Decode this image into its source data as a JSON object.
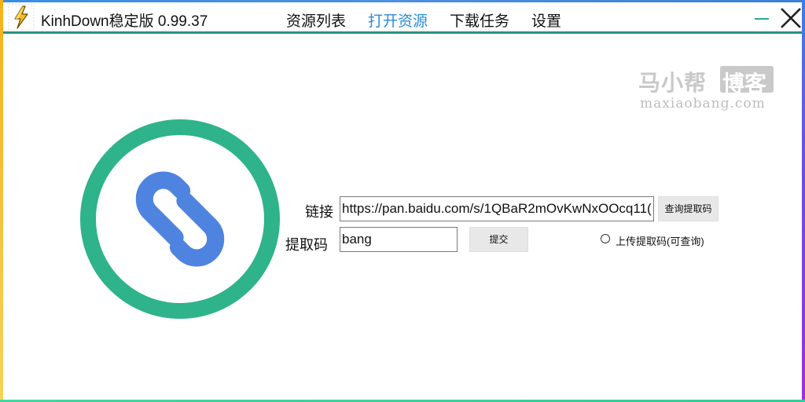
{
  "app": {
    "title": "KinhDown稳定版 0.99.37"
  },
  "nav": {
    "items": [
      {
        "label": "资源列表",
        "active": false
      },
      {
        "label": "打开资源",
        "active": true
      },
      {
        "label": "下载任务",
        "active": false
      },
      {
        "label": "设置",
        "active": false
      }
    ]
  },
  "window_controls": {
    "minimize_icon": "minimize-icon",
    "close_icon": "close-icon"
  },
  "watermark": {
    "cn": "马小帮",
    "cn_box": "博客",
    "en": "maxiaobang.com"
  },
  "form": {
    "link_label": "链接",
    "link_value": "https://pan.baidu.com/s/1QBaR2mOvKwNxOOcq11(",
    "query_button": "查询提取码",
    "code_label": "提取码",
    "code_value": "bang",
    "submit_button": "提交",
    "upload_radio_label": "上传提取码(可查询)"
  },
  "colors": {
    "accent": "#2a8bd8",
    "ring": "#2eb38a",
    "link_icon": "#4f83e0",
    "titlebar_line": "#2a8f86"
  },
  "icons": {
    "app": "lightning-app-icon",
    "logo": "chain-link-icon"
  }
}
